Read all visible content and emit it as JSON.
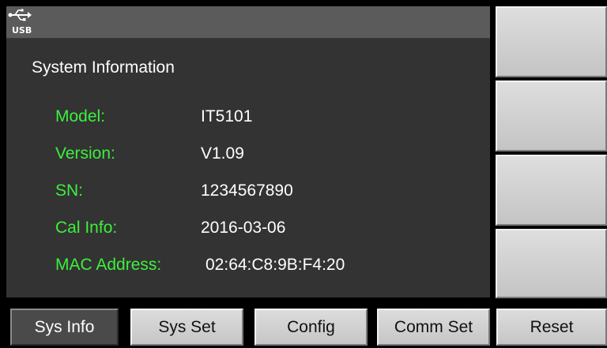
{
  "status_bar": {
    "usb_icon": "usb-icon",
    "usb_text": "USB"
  },
  "panel": {
    "title": "System Information",
    "rows": [
      {
        "label": "Model:",
        "value": "IT5101"
      },
      {
        "label": "Version:",
        "value": "V1.09"
      },
      {
        "label": "SN:",
        "value": "1234567890"
      },
      {
        "label": "Cal Info:",
        "value": "2016-03-06"
      },
      {
        "label": "MAC Address:",
        "value": "02:64:C8:9B:F4:20"
      }
    ]
  },
  "tabs": [
    {
      "label": "Sys Info",
      "active": true
    },
    {
      "label": "Sys Set",
      "active": false
    },
    {
      "label": "Config",
      "active": false
    },
    {
      "label": "Comm Set",
      "active": false
    },
    {
      "label": "Reset",
      "active": false
    }
  ],
  "colors": {
    "label_green": "#3cf03c",
    "panel_bg": "#333333",
    "status_bg": "#5b5b5b"
  }
}
